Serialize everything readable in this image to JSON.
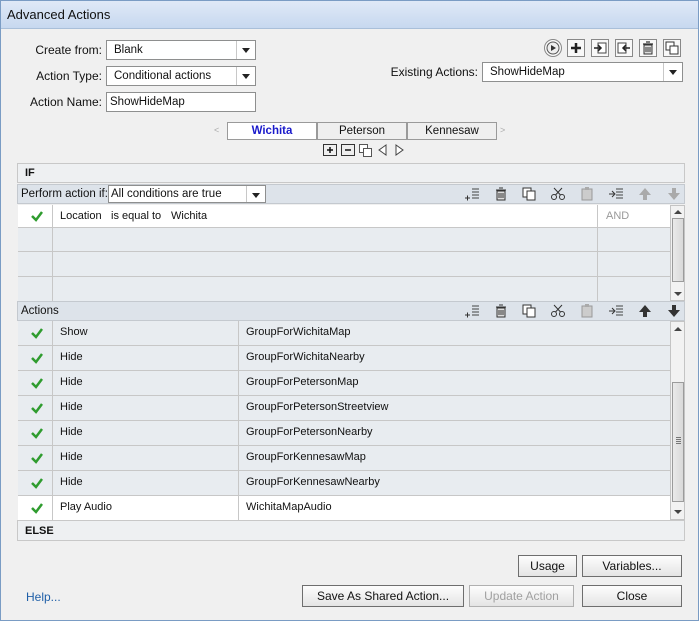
{
  "window": {
    "title": "Advanced Actions"
  },
  "form": {
    "create_from_label": "Create from:",
    "create_from_value": "Blank",
    "action_type_label": "Action Type:",
    "action_type_value": "Conditional actions",
    "action_name_label": "Action Name:",
    "action_name_value": "ShowHideMap",
    "existing_actions_label": "Existing Actions:",
    "existing_actions_value": "ShowHideMap"
  },
  "toolbar_icons": [
    "preview-icon",
    "add-icon",
    "import-icon",
    "export-icon",
    "delete-icon",
    "duplicate-icon"
  ],
  "tabs": [
    {
      "label": "Wichita",
      "active": true
    },
    {
      "label": "Peterson",
      "active": false
    },
    {
      "label": "Kennesaw",
      "active": false
    }
  ],
  "if_section": {
    "header": "IF",
    "perform_label": "Perform action if:",
    "perform_value": "All conditions are true",
    "conditions": [
      {
        "checked": true,
        "variable": "Location",
        "operator": "is equal to",
        "value": "Wichita",
        "logic": "AND"
      },
      {
        "checked": false,
        "variable": "",
        "operator": "",
        "value": "",
        "logic": ""
      },
      {
        "checked": false,
        "variable": "",
        "operator": "",
        "value": "",
        "logic": ""
      },
      {
        "checked": false,
        "variable": "",
        "operator": "",
        "value": "",
        "logic": ""
      }
    ]
  },
  "actions_section": {
    "label": "Actions",
    "rows": [
      {
        "checked": true,
        "action": "Show",
        "target": "GroupForWichitaMap"
      },
      {
        "checked": true,
        "action": "Hide",
        "target": "GroupForWichitaNearby"
      },
      {
        "checked": true,
        "action": "Hide",
        "target": "GroupForPetersonMap"
      },
      {
        "checked": true,
        "action": "Hide",
        "target": "GroupForPetersonStreetview"
      },
      {
        "checked": true,
        "action": "Hide",
        "target": "GroupForPetersonNearby"
      },
      {
        "checked": true,
        "action": "Hide",
        "target": "GroupForKennesawMap"
      },
      {
        "checked": true,
        "action": "Hide",
        "target": "GroupForKennesawNearby"
      },
      {
        "checked": true,
        "action": "Play Audio",
        "target": "WichitaMapAudio"
      }
    ]
  },
  "else_section": {
    "header": "ELSE"
  },
  "buttons": {
    "usage": "Usage",
    "variables": "Variables...",
    "save_shared": "Save As Shared Action...",
    "update": "Update Action",
    "close": "Close",
    "help": "Help..."
  }
}
